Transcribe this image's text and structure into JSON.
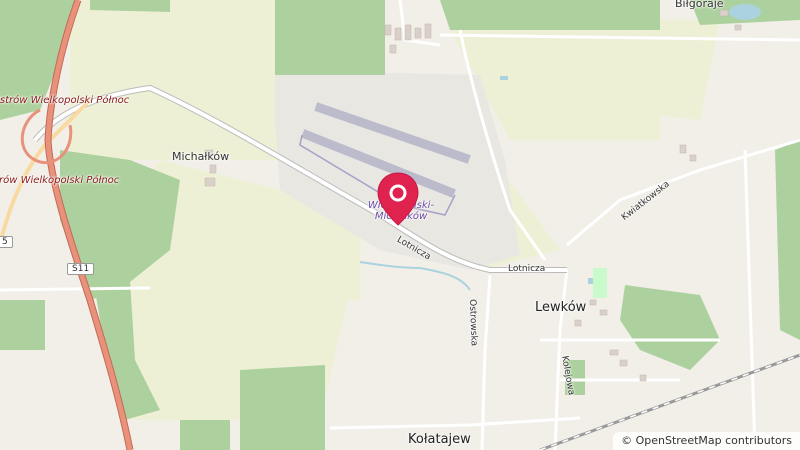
{
  "map": {
    "places": {
      "bilgoraje": "Biłgoraje",
      "michalkow": "Michałków",
      "lewkow": "Lewków",
      "kolatajew": "Kołatajew"
    },
    "junctions": {
      "north_top": "Ostrów Wielkopolski Północ",
      "north_mid": "Ostrów Wielkopolski Północ"
    },
    "streets": {
      "lotnicza_1": "Lotnicza",
      "lotnicza_2": "Lotnicza",
      "ostrowska": "Ostrowska",
      "kwiatkowska": "Kwiatkowska",
      "kolejowa": "Kolejowa"
    },
    "shields": {
      "s11": "S11",
      "edge": "5"
    },
    "airport": {
      "line1": "Wielkopolski-",
      "line2": "Michałków",
      "prefix": "w"
    },
    "marker": {
      "icon": "map-pin-icon",
      "color": "#e0224f"
    },
    "attribution": "© OpenStreetMap contributors",
    "colors": {
      "land": "#f2efe9",
      "farmland": "#eef0d5",
      "forest": "#add19e",
      "airport": "#e9e7e2",
      "runway": "#bbbbcc",
      "motorway": "#e8927c",
      "trunk": "#f9d9a0"
    }
  }
}
